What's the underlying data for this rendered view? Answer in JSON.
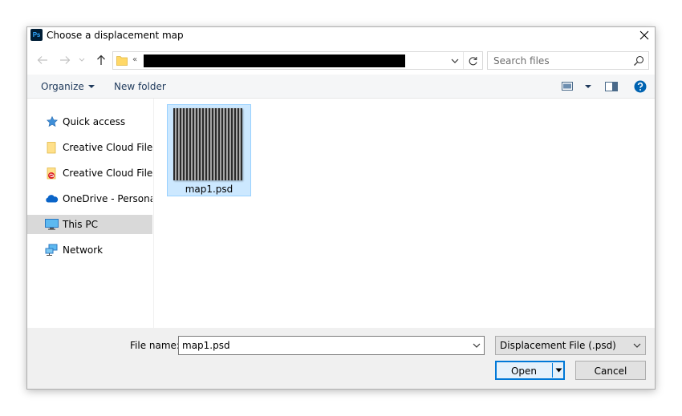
{
  "window": {
    "app_icon_label": "Ps",
    "title": "Choose a displacement map"
  },
  "navigation": {
    "path_prefix": "«",
    "search_placeholder": "Search files"
  },
  "toolbar": {
    "organize_label": "Organize",
    "new_folder_label": "New folder"
  },
  "sidebar": {
    "items": [
      {
        "label": "Quick access",
        "icon": "star-pin-icon"
      },
      {
        "label": "Creative Cloud Files n",
        "icon": "folder-icon"
      },
      {
        "label": "Creative Cloud Files P",
        "icon": "creative-cloud-folder-icon"
      },
      {
        "label": "OneDrive - Personal",
        "icon": "cloud-icon"
      },
      {
        "label": "This PC",
        "icon": "monitor-icon"
      },
      {
        "label": "Network",
        "icon": "network-icon"
      }
    ],
    "selected": "This PC"
  },
  "files": [
    {
      "name": "map1.psd"
    }
  ],
  "footer": {
    "file_name_label": "File name:",
    "file_name_value": "map1.psd",
    "file_type_value": "Displacement File (.psd)",
    "open_label": "Open",
    "cancel_label": "Cancel"
  },
  "colors": {
    "accent": "#0078d7",
    "selection_bg": "#cce8ff",
    "help_icon": "#0063b1",
    "photoshop_bg": "#001e36",
    "photoshop_fg": "#31a8ff"
  }
}
